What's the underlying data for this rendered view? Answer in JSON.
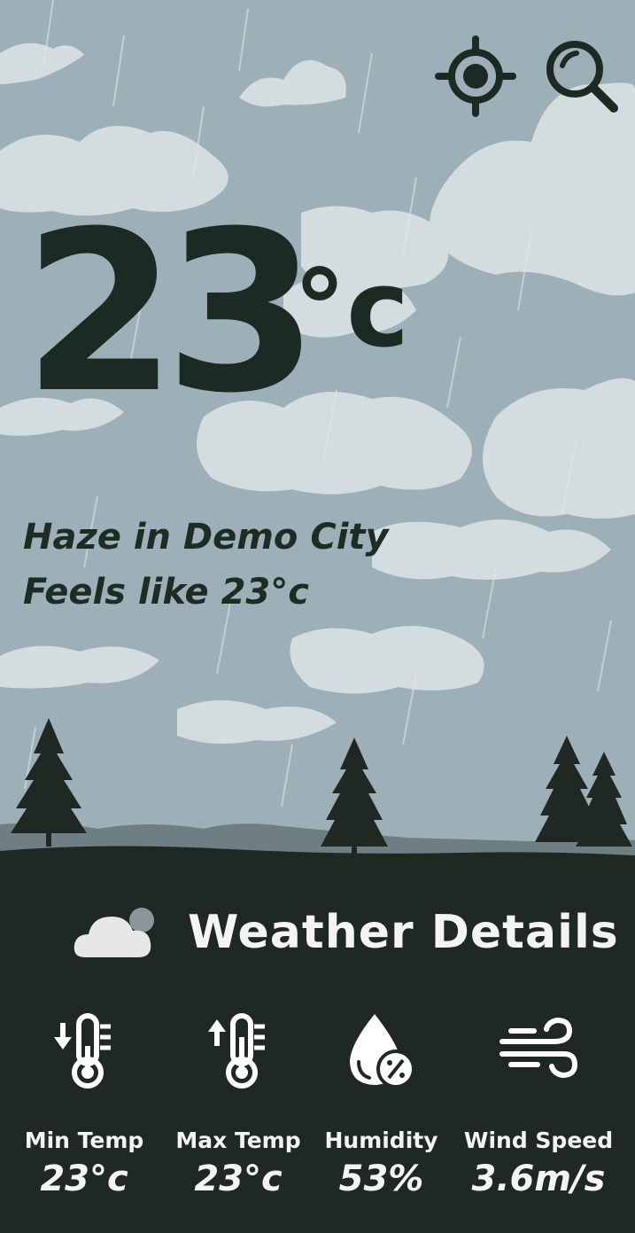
{
  "topbar": {
    "location_icon": "crosshair-location-icon",
    "search_icon": "search-icon"
  },
  "current": {
    "temperature": "23",
    "unit": "°c",
    "condition_line": "Haze in Demo City",
    "feels_like_line": "Feels like 23°c"
  },
  "details": {
    "title": "Weather Details",
    "title_icon": "cloud-icon",
    "items": [
      {
        "icon": "thermometer-down-icon",
        "label": "Min Temp",
        "value": "23°c"
      },
      {
        "icon": "thermometer-up-icon",
        "label": "Max Temp",
        "value": "23°c"
      },
      {
        "icon": "humidity-drop-icon",
        "label": "Humidity",
        "value": "53%"
      },
      {
        "icon": "wind-icon",
        "label": "Wind Speed",
        "value": "3.6m/s"
      }
    ]
  },
  "colors": {
    "sky": "#9fb1b8",
    "cloud": "#d3dcde",
    "ink": "#1c2a24",
    "ground": "#1f2823",
    "text_light": "#f4f4f4"
  }
}
